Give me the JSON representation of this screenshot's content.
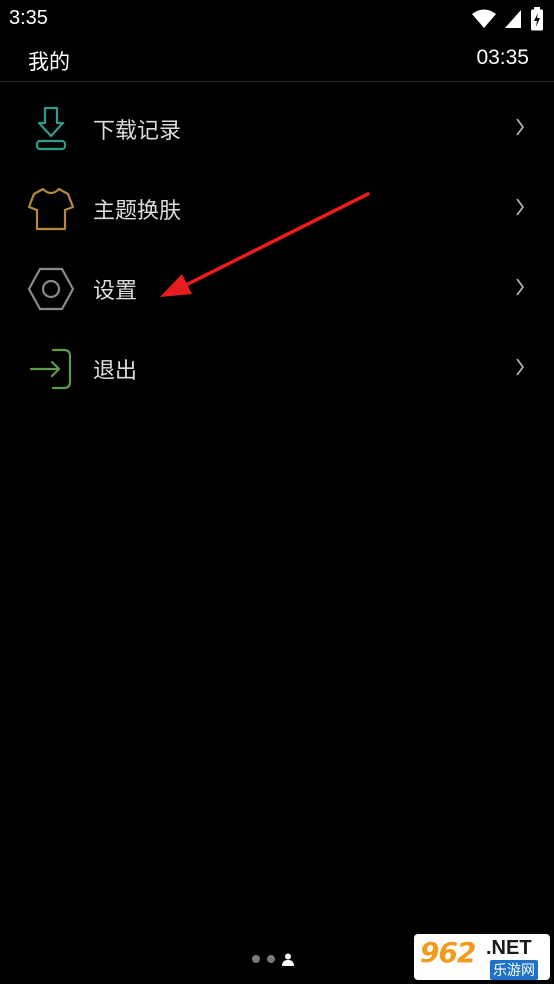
{
  "status_bar": {
    "time": "3:35",
    "icons": [
      "wifi-icon",
      "cell-signal-icon",
      "battery-charging-icon"
    ]
  },
  "header": {
    "title": "我的",
    "clock": "03:35"
  },
  "menu": {
    "items": [
      {
        "label": "下载记录",
        "icon": "download-icon",
        "icon_color": "#2e9c8a"
      },
      {
        "label": "主题换肤",
        "icon": "shirt-icon",
        "icon_color": "#b68a3e"
      },
      {
        "label": "设置",
        "icon": "settings-hex-icon",
        "icon_color": "#8a8a8a"
      },
      {
        "label": "退出",
        "icon": "logout-icon",
        "icon_color": "#5f9a4a"
      }
    ],
    "chevron_icon": "chevron-right-icon"
  },
  "annotation": {
    "arrow_color": "#e41e1e"
  },
  "pager": {
    "count": 3,
    "active_index": 2,
    "active_icon": "person-icon"
  },
  "watermark": {
    "number": "962",
    "domain": ".NET",
    "chinese": "乐游网"
  }
}
